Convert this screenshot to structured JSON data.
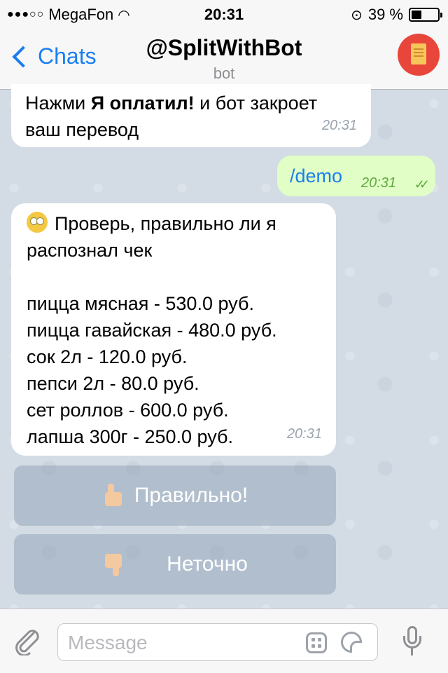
{
  "status_bar": {
    "carrier": "MegaFon",
    "time": "20:31",
    "battery": "39 %",
    "battery_level": 0.39
  },
  "nav": {
    "back_label": "Chats",
    "title": "@SplitWithBot",
    "subtitle": "bot"
  },
  "messages": [
    {
      "id": "m1",
      "lines": [
        "Нажми",
        "Я оплатил!",
        "и бот закроет",
        "ваш перевод"
      ],
      "time": "20:31"
    },
    {
      "id": "m2",
      "text": "/demo",
      "time": "20:31"
    },
    {
      "id": "m3",
      "header_line1": "Проверь, правильно ли я",
      "header_line2": "распознал чек",
      "items": [
        {
          "name": "пицца мясная",
          "price": "530.0 руб."
        },
        {
          "name": "пицца гавайская",
          "price": "480.0 руб."
        },
        {
          "name": "сок 2л",
          "price": "120.0 руб."
        },
        {
          "name": "пепси 2л",
          "price": "80.0 руб."
        },
        {
          "name": "сет роллов",
          "price": "600.0 руб."
        },
        {
          "name": "лапша 300г",
          "price": "250.0 руб."
        }
      ],
      "time": "20:31"
    }
  ],
  "keyboard": [
    {
      "label": "Правильно!",
      "icon": "thumbs-up-icon"
    },
    {
      "label": "Неточно",
      "icon": "thumbs-down-icon"
    }
  ],
  "input": {
    "placeholder": "Message"
  }
}
